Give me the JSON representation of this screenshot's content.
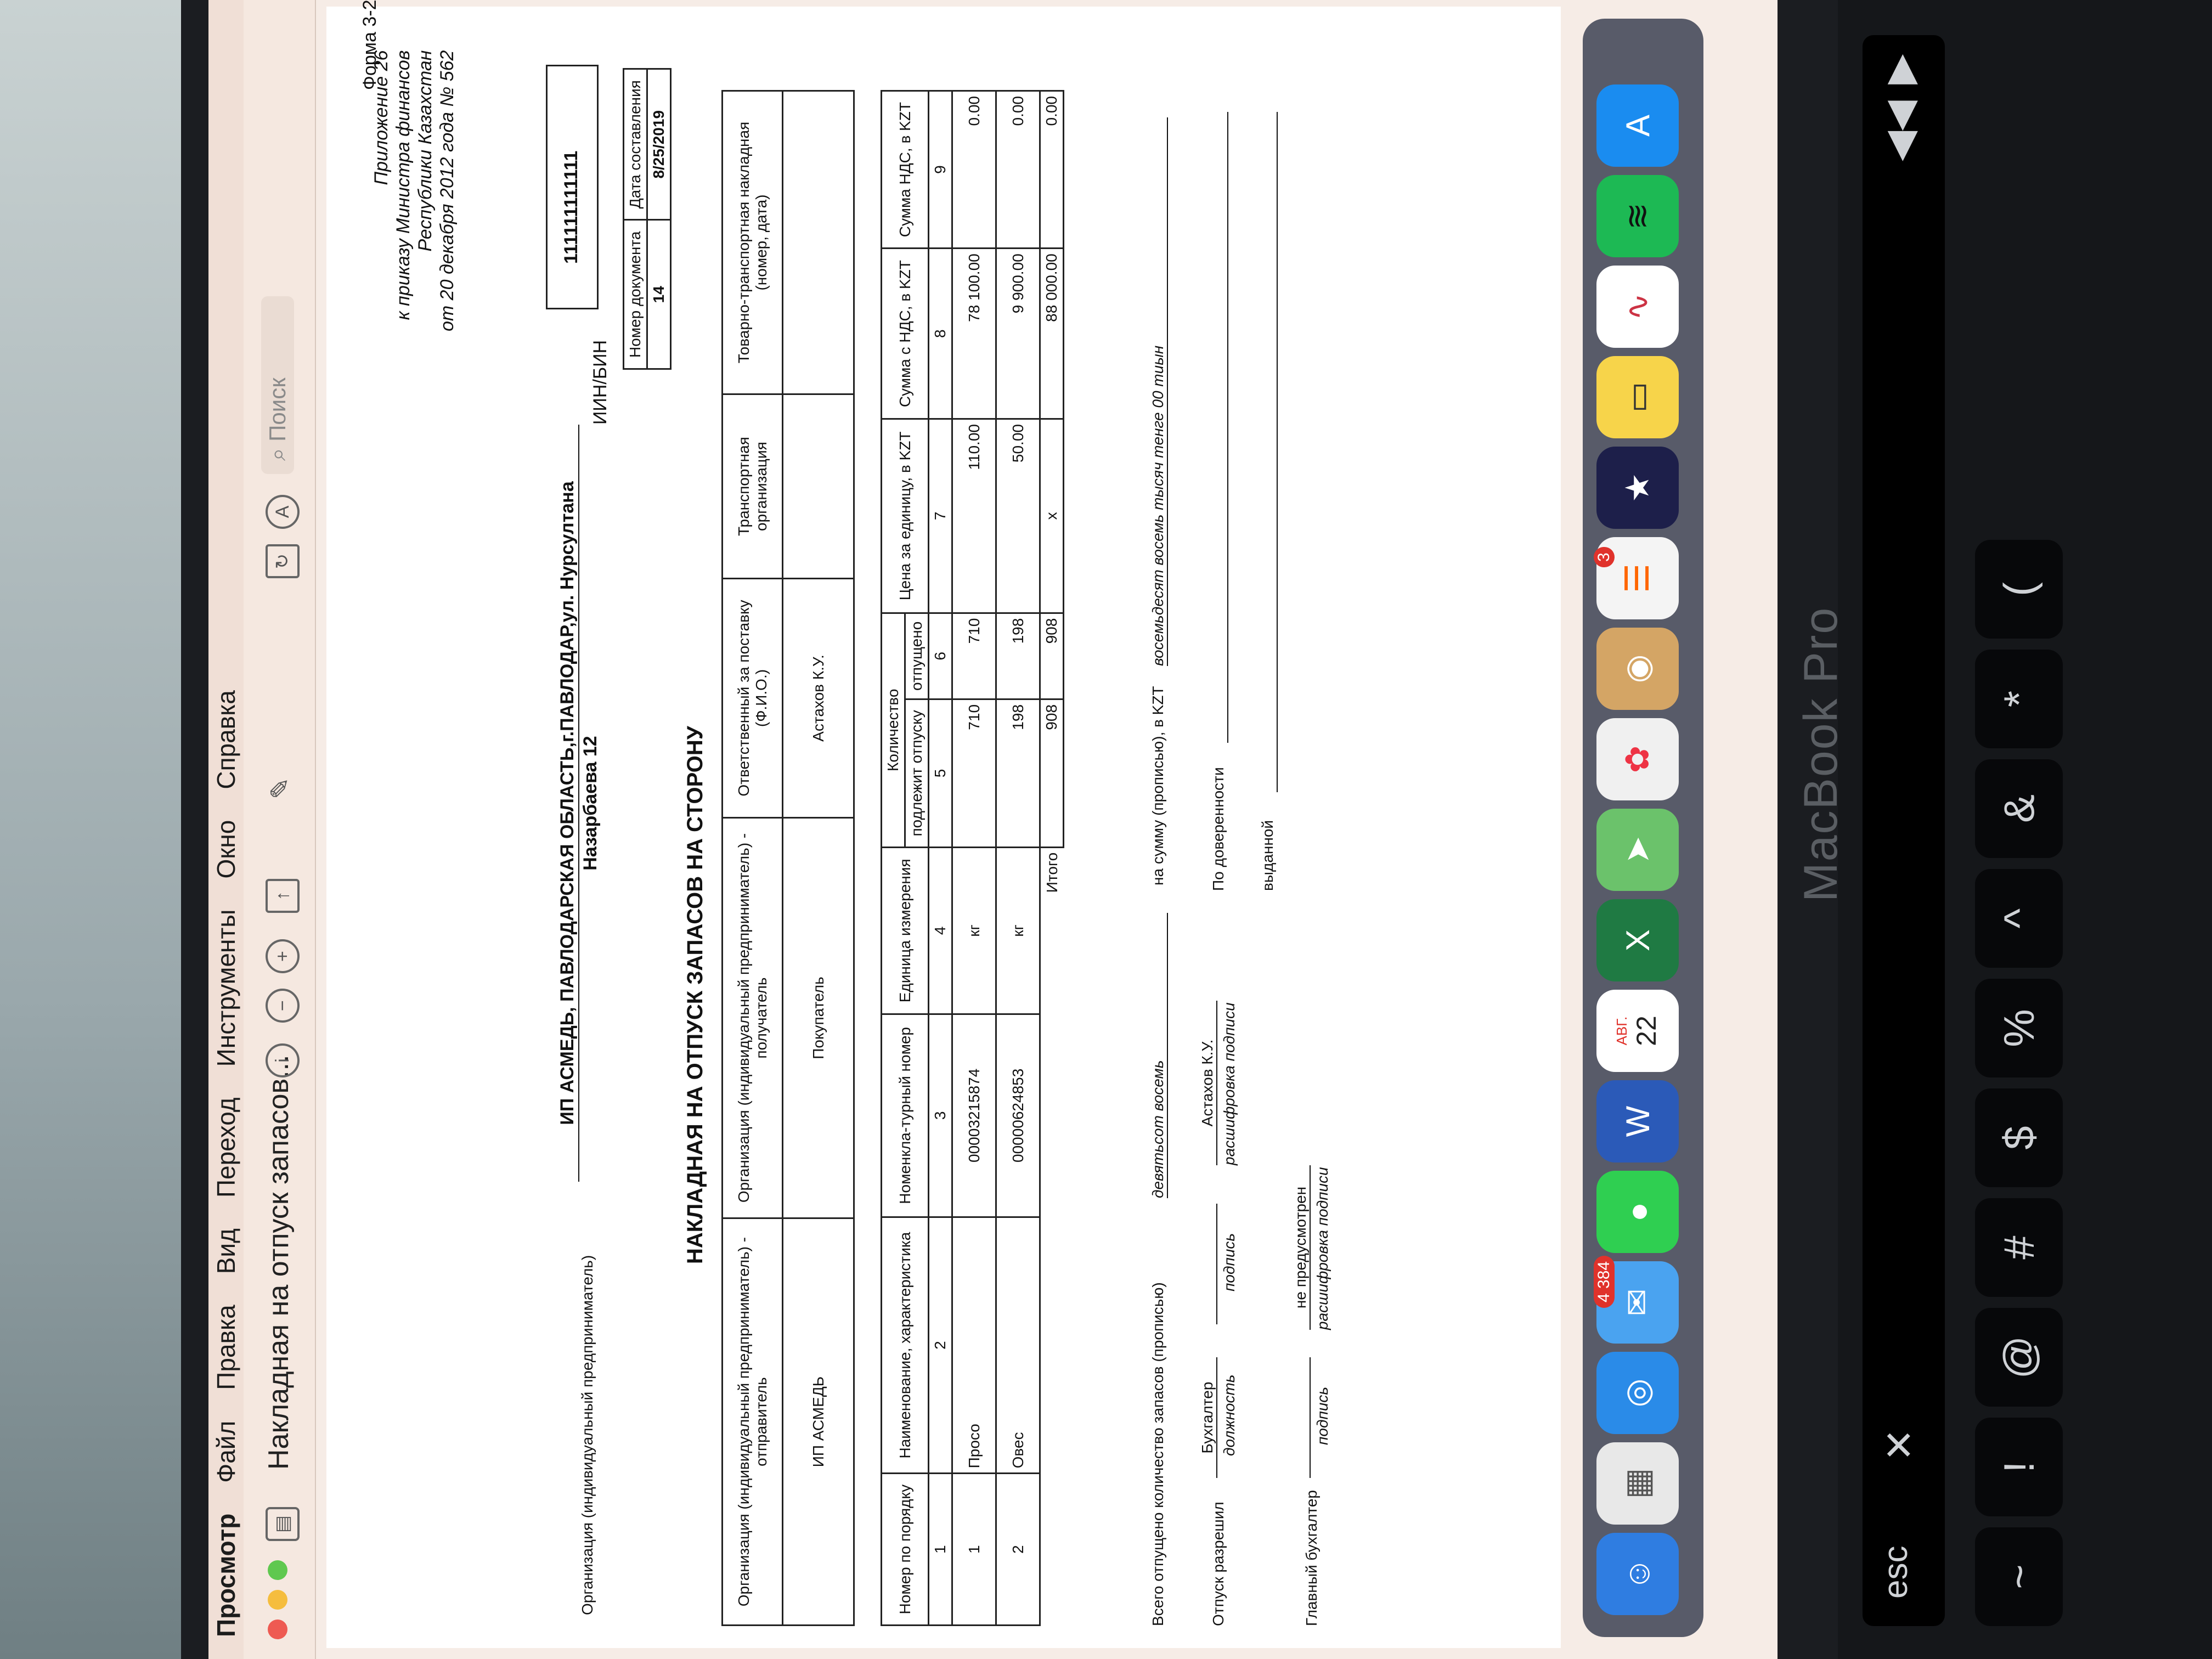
{
  "menubar": {
    "app": "Просмотр",
    "items": [
      "Файл",
      "Правка",
      "Вид",
      "Переход",
      "Инструменты",
      "Окно",
      "Справка"
    ]
  },
  "window": {
    "title": "Накладная на отпуск запасов...",
    "search_placeholder": "Поиск"
  },
  "document": {
    "appendix": [
      "Приложение 26",
      "к приказу Министра финансов",
      "Республики Казахстан",
      "от 20 декабря 2012 года № 562"
    ],
    "form": "Форма 3-2",
    "org_label": "Организация (индивидуальный предприниматель)",
    "org_value_line1": "ИП АСМЕДЬ, ПАВЛОДАРСКАЯ ОБЛАСТЬ,г.ПАВЛОДАР,ул. Нурсултана",
    "org_value_line2": "Назарбаева 12",
    "iin_label": "ИИН/БИН",
    "iin_value": "111111111111",
    "doc_number_label": "Номер документа",
    "doc_date_label": "Дата составления",
    "doc_number": "14",
    "doc_date": "8/25/2019",
    "heading": "НАКЛАДНАЯ НА ОТПУСК ЗАПАСОВ НА СТОРОНУ",
    "parties": {
      "headers": [
        "Организация (индивидуальный предприниматель) - отправитель",
        "Организация (индивидуальный предприниматель) - получатель",
        "Ответственный за поставку (Ф.И.О.)",
        "Транспортная организация",
        "Товарно-транспортная накладная (номер, дата)"
      ],
      "values": [
        "ИП АСМЕДЬ",
        "Покупатель",
        "Астахов К.У.",
        "",
        ""
      ]
    },
    "items_table": {
      "h_num": "Номер по порядку",
      "h_name": "Наименование, характеристика",
      "h_code": "Номенкла-турный номер",
      "h_unit": "Единица измерения",
      "h_qty": "Количество",
      "h_qty_due": "подлежит отпуску",
      "h_qty_rel": "отпущено",
      "h_price": "Цена за единицу, в KZT",
      "h_sum": "Сумма с НДС, в KZT",
      "h_vat": "Сумма НДС, в KZT",
      "col_numbers": [
        "1",
        "2",
        "3",
        "4",
        "5",
        "6",
        "7",
        "8",
        "9"
      ],
      "rows": [
        {
          "n": "1",
          "name": "Просо",
          "code": "00003215874",
          "unit": "кг",
          "due": "710",
          "rel": "710",
          "price": "110.00",
          "sum": "78 100.00",
          "vat": "0.00"
        },
        {
          "n": "2",
          "name": "Овес",
          "code": "00000624853",
          "unit": "кг",
          "due": "198",
          "rel": "198",
          "price": "50.00",
          "sum": "9 900.00",
          "vat": "0.00"
        }
      ],
      "total_label": "Итого",
      "total_due": "908",
      "total_rel": "908",
      "total_price": "x",
      "total_sum": "88 000.00",
      "total_vat": "0.00"
    },
    "footer": {
      "released_qty_label": "Всего отпущено количество запасов (прописью)",
      "released_qty_value": "девятьсот восемь",
      "sum_label": "на сумму (прописью), в KZT",
      "sum_value": "восемьдесят восемь тысяч тенге 00 тиын",
      "release_allowed": "Отпуск разрешил",
      "position_value": "Бухгалтер",
      "position_caption": "должность",
      "signature_caption": "подпись",
      "decode_value": "Астахов К.У.",
      "decode_caption": "расшифровка подписи",
      "chief_accountant": "Главный бухгалтер",
      "chief_decode": "не предусмотрен",
      "proxy_label": "По доверенности",
      "issued_label": "выданной"
    }
  },
  "dock": {
    "calendar_month": "АВГ.",
    "calendar_day": "22",
    "mail_badge": "4 384",
    "reminders_badge": "3"
  },
  "hardware": {
    "laptop_label": "MacBook Pro",
    "esc": "esc"
  },
  "colors": {
    "menubar_bg": "#f0dfd6",
    "close": "#ee5a52",
    "minimize": "#f5bd3e",
    "zoom": "#5fc84f"
  }
}
